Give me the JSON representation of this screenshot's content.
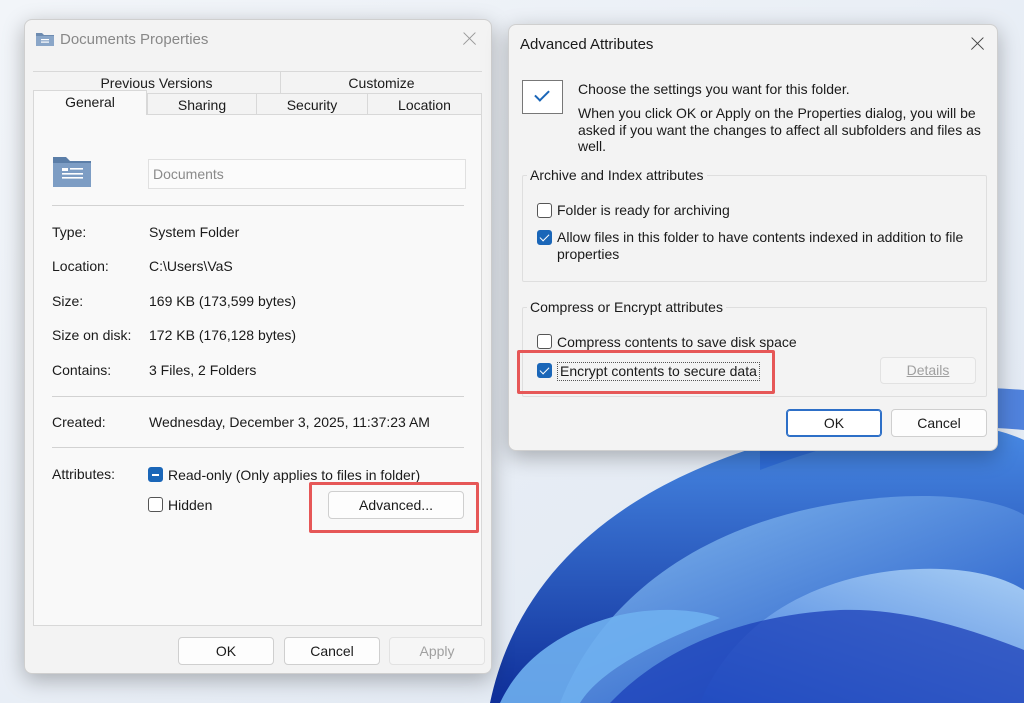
{
  "properties": {
    "title": "Documents Properties",
    "tabs_top": [
      "Previous Versions",
      "Customize"
    ],
    "tabs_bottom": [
      "General",
      "Sharing",
      "Security",
      "Location"
    ],
    "active_tab": "General",
    "folder_name": "Documents",
    "info": [
      {
        "label": "Type:",
        "value": "System Folder"
      },
      {
        "label": "Location:",
        "value": "C:\\Users\\VaS"
      },
      {
        "label": "Size:",
        "value": "169 KB (173,599 bytes)"
      },
      {
        "label": "Size on disk:",
        "value": "172 KB (176,128 bytes)"
      },
      {
        "label": "Contains:",
        "value": "3 Files, 2 Folders"
      }
    ],
    "created_label": "Created:",
    "created_value": "Wednesday, December 3, 2025, 11:37:23 AM",
    "attributes_label": "Attributes:",
    "readonly_label": "Read-only (Only applies to files in folder)",
    "readonly_state": "indeterminate",
    "hidden_label": "Hidden",
    "hidden_checked": false,
    "advanced_button": "Advanced...",
    "ok": "OK",
    "cancel": "Cancel",
    "apply": "Apply"
  },
  "advanced": {
    "title": "Advanced Attributes",
    "intro_line1": "Choose the settings you want for this folder.",
    "intro_line2": "When you click OK or Apply on the Properties dialog, you will be asked if you want the changes to affect all subfolders and files as well.",
    "archive_group": "Archive and Index attributes",
    "ready_archiving": "Folder is ready for archiving",
    "ready_archiving_checked": false,
    "allow_index": "Allow files in this folder to have contents indexed in addition to file properties",
    "allow_index_checked": true,
    "compress_group": "Compress or Encrypt attributes",
    "compress": "Compress contents to save disk space",
    "compress_checked": false,
    "encrypt": "Encrypt contents to secure data",
    "encrypt_checked": true,
    "details": "Details",
    "ok": "OK",
    "cancel": "Cancel"
  },
  "colors": {
    "accent": "#1a66b8",
    "highlight": "#e65757"
  }
}
